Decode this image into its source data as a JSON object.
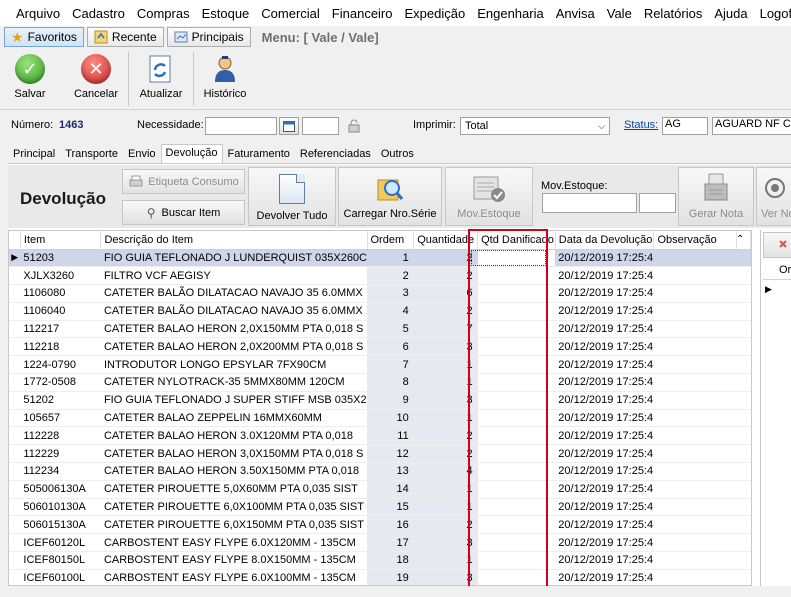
{
  "menubar": {
    "items": [
      "Arquivo",
      "Cadastro",
      "Compras",
      "Estoque",
      "Comercial",
      "Financeiro",
      "Expedição",
      "Engenharia",
      "Anvisa",
      "Vale",
      "Relatórios",
      "Ajuda",
      "Logoff"
    ]
  },
  "navbar": {
    "favoritos": "Favoritos",
    "recente": "Recente",
    "principais": "Principais",
    "menu_title": "Menu: [ Vale / Vale]"
  },
  "toolbar": {
    "salvar": "Salvar",
    "cancelar": "Cancelar",
    "atualizar": "Atualizar",
    "historico": "Histórico"
  },
  "form": {
    "numero_label": "Número:",
    "numero_value": "1463",
    "necessidade_label": "Necessidade:",
    "necessidade_value": "",
    "imprimir_label": "Imprimir:",
    "imprimir_value": "Total",
    "status_label": "Status:",
    "status_code": "AG",
    "status_desc": "AGUARD NF CO"
  },
  "subtabs": [
    "Principal",
    "Transporte",
    "Envio",
    "Devolução",
    "Faturamento",
    "Referenciadas",
    "Outros"
  ],
  "actions": {
    "title": "Devolução",
    "etiqueta": "Etiqueta Consumo",
    "buscar": "Buscar Item",
    "devolver_tudo": "Devolver Tudo",
    "carregar": "Carregar Nro.Série",
    "mov_estoque_btn": "Mov.Estoque",
    "mov_estoque_label": "Mov.Estoque:",
    "gerar_nota": "Gerar Nota",
    "ver_nota": "Ver No"
  },
  "grid": {
    "columns": [
      "Item",
      "Descrição do Item",
      "Ordem",
      "Quantidade",
      "Qtd Danificado",
      "Data da Devolução",
      "Observação"
    ],
    "rows": [
      [
        "51203",
        "FIO GUIA TEFLONADO J LUNDERQUIST 035X260C",
        "1",
        "2",
        "",
        "20/12/2019 17:25:4",
        ""
      ],
      [
        "XJLX3260",
        "FILTRO VCF AEGISY",
        "2",
        "2",
        "",
        "20/12/2019 17:25:4",
        ""
      ],
      [
        "1106080",
        "CATETER BALÃO DILATACAO NAVAJO 35 6.0MMX",
        "3",
        "6",
        "",
        "20/12/2019 17:25:4",
        ""
      ],
      [
        "1106040",
        "CATETER BALÃO DILATACAO NAVAJO 35 6.0MMX",
        "4",
        "2",
        "",
        "20/12/2019 17:25:4",
        ""
      ],
      [
        "112217",
        "CATETER BALAO HERON 2,0X150MM PTA 0,018 S",
        "5",
        "7",
        "",
        "20/12/2019 17:25:4",
        ""
      ],
      [
        "112218",
        "CATETER BALAO HERON 2,0X200MM PTA 0,018 S",
        "6",
        "3",
        "",
        "20/12/2019 17:25:4",
        ""
      ],
      [
        "1224-0790",
        "INTRODUTOR LONGO EPSYLAR 7FX90CM",
        "7",
        "1",
        "",
        "20/12/2019 17:25:4",
        ""
      ],
      [
        "1772-0508",
        "CATETER NYLOTRACK-35 5MMX80MM 120CM",
        "8",
        "1",
        "",
        "20/12/2019 17:25:4",
        ""
      ],
      [
        "51202",
        "FIO GUIA TEFLONADO J SUPER STIFF MSB 035X2",
        "9",
        "3",
        "",
        "20/12/2019 17:25:4",
        ""
      ],
      [
        "105657",
        "CATETER BALAO ZEPPELIN 16MMX60MM",
        "10",
        "1",
        "",
        "20/12/2019 17:25:4",
        ""
      ],
      [
        "112228",
        "CATETER BALAO HERON 3.0X120MM  PTA 0,018",
        "11",
        "2",
        "",
        "20/12/2019 17:25:4",
        ""
      ],
      [
        "112229",
        "CATETER BALAO HERON 3,0X150MM PTA 0,018 S",
        "12",
        "2",
        "",
        "20/12/2019 17:25:4",
        ""
      ],
      [
        "112234",
        "CATETER BALAO HERON 3.50X150MM  PTA 0,018",
        "13",
        "4",
        "",
        "20/12/2019 17:25:4",
        ""
      ],
      [
        "505006130A",
        "CATETER PIROUETTE 5,0X60MM PTA 0,035  SIST",
        "14",
        "1",
        "",
        "20/12/2019 17:25:4",
        ""
      ],
      [
        "506010130A",
        "CATETER PIROUETTE 6,0X100MM PTA 0,035  SIST",
        "15",
        "1",
        "",
        "20/12/2019 17:25:4",
        ""
      ],
      [
        "506015130A",
        "CATETER PIROUETTE 6,0X150MM PTA 0,035  SIST",
        "16",
        "2",
        "",
        "20/12/2019 17:25:4",
        ""
      ],
      [
        "ICEF60120L",
        "CARBOSTENT EASY FLYPE 6.0X120MM - 135CM",
        "17",
        "3",
        "",
        "20/12/2019 17:25:4",
        ""
      ],
      [
        "ICEF80150L",
        "CARBOSTENT EASY FLYPE 8.0X150MM - 135CM",
        "18",
        "1",
        "",
        "20/12/2019 17:25:4",
        ""
      ],
      [
        "ICEF60100L",
        "CARBOSTENT EASY FLYPE 6.0X100MM - 135CM",
        "19",
        "3",
        "",
        "20/12/2019 17:25:4",
        ""
      ]
    ]
  },
  "right_panel": {
    "header": "Ord"
  }
}
